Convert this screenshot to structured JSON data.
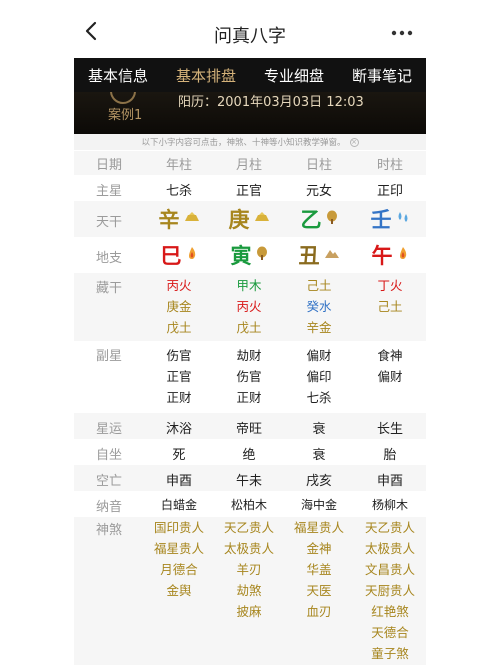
{
  "nav": {
    "title": "问真八字"
  },
  "tabs": [
    {
      "label": "基本信息",
      "active": false
    },
    {
      "label": "基本排盘",
      "active": true
    },
    {
      "label": "专业细盘",
      "active": false
    },
    {
      "label": "断事笔记",
      "active": false
    }
  ],
  "banner": {
    "case_name": "案例1",
    "solar_date": "阳历：2001年03月03日 12:03"
  },
  "hint": "以下小字内容可点击，神煞、十神等小知识教学弹窗。",
  "labels": {
    "header": "日期",
    "zhuxing": "主星",
    "tiangan": "天干",
    "dizhi": "地支",
    "canggan": "藏干",
    "fuxing": "副星",
    "xingyun": "星运",
    "zizuo": "自坐",
    "kongwang": "空亡",
    "nayin": "纳音",
    "shensha": "神煞"
  },
  "columns": [
    "年柱",
    "月柱",
    "日柱",
    "时柱"
  ],
  "zhuxing": [
    "七杀",
    "正官",
    "元女",
    "正印"
  ],
  "tiangan": [
    "辛",
    "庚",
    "乙",
    "壬"
  ],
  "dizhi": [
    "巳",
    "寅",
    "丑",
    "午"
  ],
  "canggan": [
    [
      "丙火",
      "庚金",
      "戊土"
    ],
    [
      "甲木",
      "丙火",
      "戊土"
    ],
    [
      "己土",
      "癸水",
      "辛金"
    ],
    [
      "丁火",
      "己土"
    ]
  ],
  "fuxing": [
    [
      "伤官",
      "正官",
      "正财"
    ],
    [
      "劫财",
      "伤官",
      "正财"
    ],
    [
      "偏财",
      "偏印",
      "七杀"
    ],
    [
      "食神",
      "偏财"
    ]
  ],
  "xingyun": [
    "沐浴",
    "帝旺",
    "衰",
    "长生"
  ],
  "zizuo": [
    "死",
    "绝",
    "衰",
    "胎"
  ],
  "kongwang": [
    "申酉",
    "午未",
    "戌亥",
    "申酉"
  ],
  "nayin": [
    "白蜡金",
    "松柏木",
    "海中金",
    "杨柳木"
  ],
  "shensha": [
    [
      "国印贵人",
      "福星贵人",
      "月德合",
      "金舆"
    ],
    [
      "天乙贵人",
      "太极贵人",
      "羊刃",
      "劫煞",
      "披麻"
    ],
    [
      "福星贵人",
      "金神",
      "华盖",
      "天医",
      "血刃"
    ],
    [
      "天乙贵人",
      "太极贵人",
      "文昌贵人",
      "天厨贵人",
      "红艳煞",
      "天德合",
      "童子煞"
    ]
  ],
  "colors": {
    "gold": "#a7861e",
    "fire": "#d81818",
    "wood": "#1a9a3e",
    "water": "#3474c6",
    "earth": "#8a6b1e",
    "tab_active": "#d4b27a"
  },
  "icons": {
    "tiangan": [
      "metal-ingot-icon",
      "metal-ingot-icon",
      "wood-icon",
      "water-drop-icon"
    ],
    "dizhi": [
      "fire-icon",
      "wood-icon",
      "earth-mound-icon",
      "fire-icon"
    ]
  }
}
